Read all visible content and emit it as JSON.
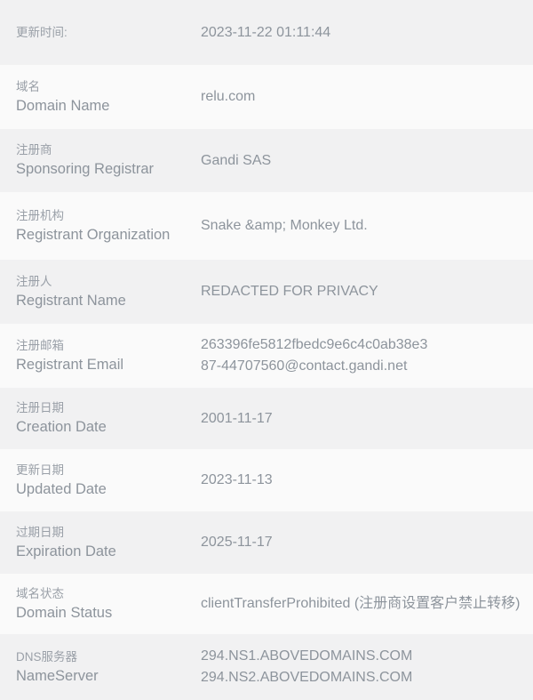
{
  "table": {
    "rows": [
      {
        "label_cn": "更新时间:",
        "label_en": "",
        "value": "2023-11-22 01:11:44"
      },
      {
        "label_cn": "域名",
        "label_en": "Domain Name",
        "value": "relu.com"
      },
      {
        "label_cn": "注册商",
        "label_en": "Sponsoring Registrar",
        "value": "Gandi SAS"
      },
      {
        "label_cn": "注册机构",
        "label_en": "Registrant Organization",
        "value": "Snake &amp; Monkey Ltd."
      },
      {
        "label_cn": "注册人",
        "label_en": "Registrant Name",
        "value": "REDACTED FOR PRIVACY"
      },
      {
        "label_cn": "注册邮箱",
        "label_en": "Registrant Email",
        "value": "263396fe5812fbedc9e6c4c0ab38e3\n87-44707560@contact.gandi.net"
      },
      {
        "label_cn": "注册日期",
        "label_en": "Creation Date",
        "value": "2001-11-17"
      },
      {
        "label_cn": "更新日期",
        "label_en": "Updated Date",
        "value": "2023-11-13"
      },
      {
        "label_cn": "过期日期",
        "label_en": "Expiration Date",
        "value": "2025-11-17"
      },
      {
        "label_cn": "域名状态",
        "label_en": "Domain Status",
        "value": "clientTransferProhibited (注册商设置客户禁止转移)"
      },
      {
        "label_cn": "DNS服务器",
        "label_en": "NameServer",
        "value": "294.NS1.ABOVEDOMAINS.COM\n294.NS2.ABOVEDOMAINS.COM"
      }
    ]
  },
  "colors": {
    "row_shade_a": "#f1f1f2",
    "row_shade_b": "#fafafa",
    "label_cn": "#9aa0a8",
    "label_en": "#8d949c",
    "value": "#8d949c"
  }
}
